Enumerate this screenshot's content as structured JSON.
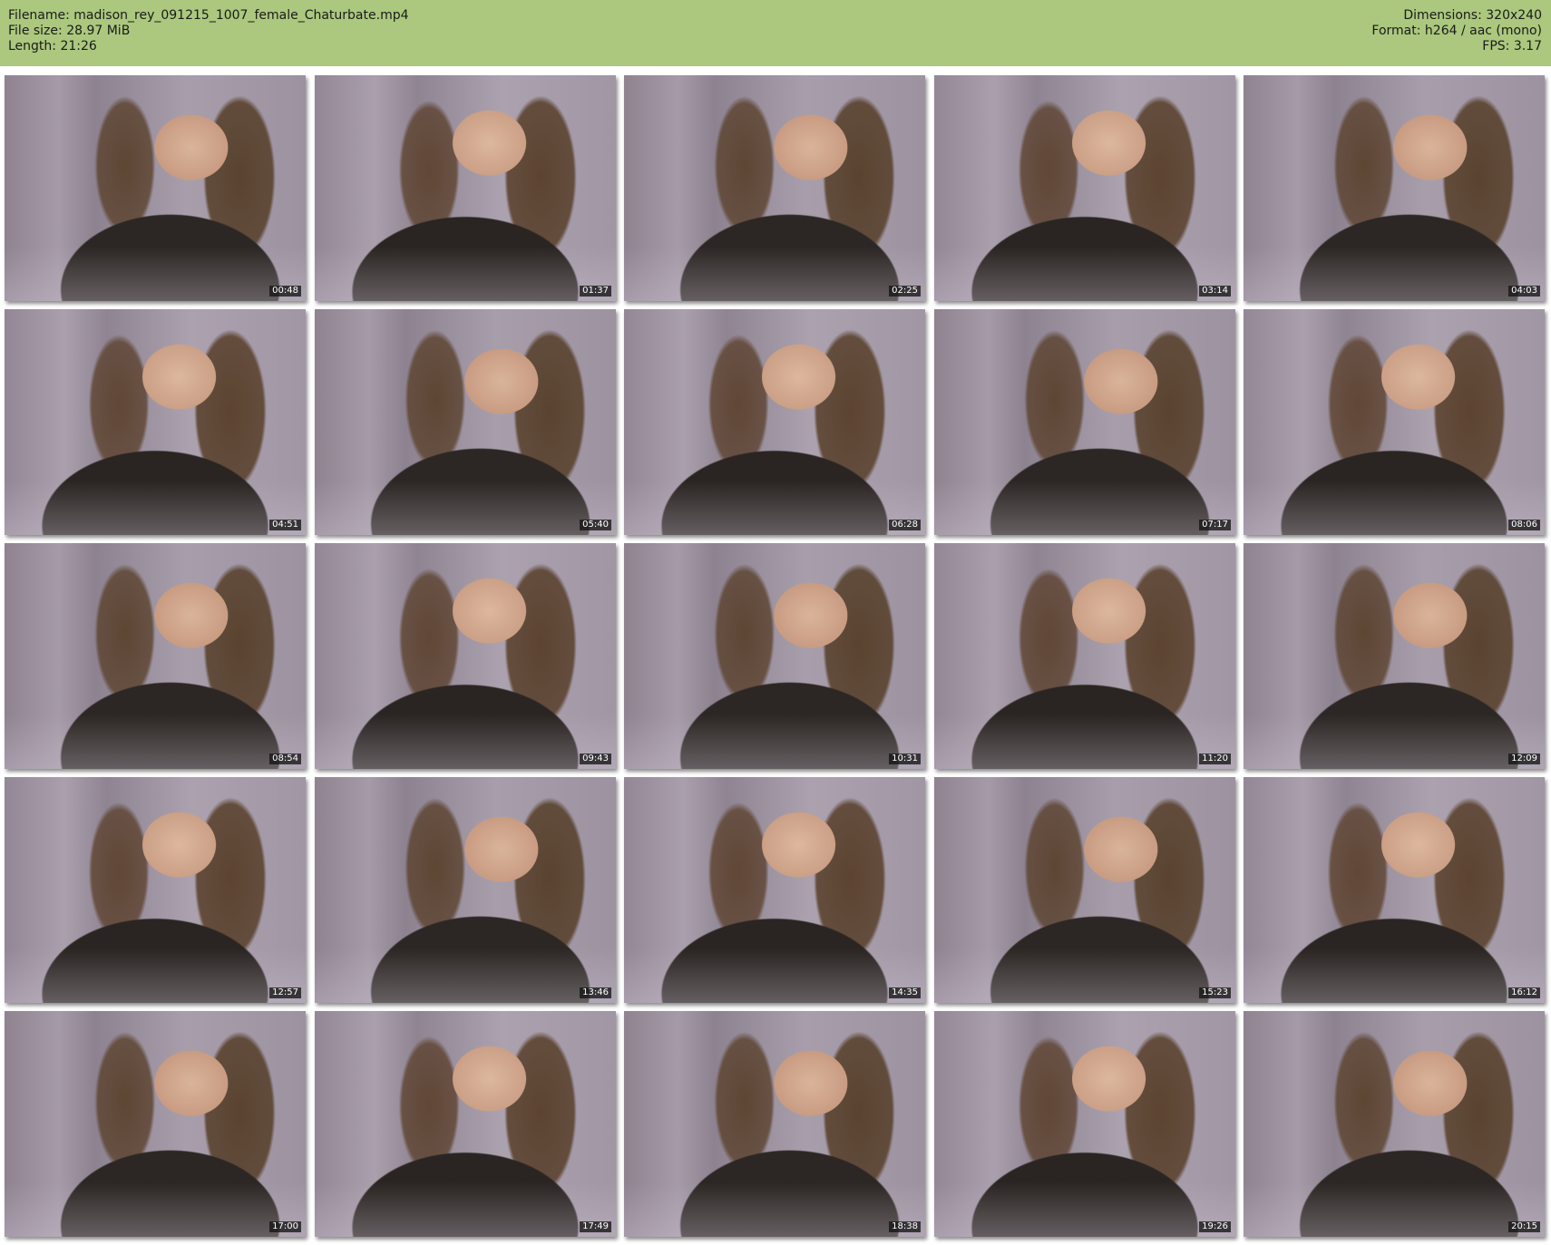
{
  "header": {
    "filename": "Filename: madison_rey_091215_1007_female_Chaturbate.mp4",
    "file_size": "File size: 28.97 MiB",
    "length": "Length: 21:26",
    "dimensions": "Dimensions: 320x240",
    "format": "Format: h264 / aac (mono)",
    "fps": "FPS: 3.17"
  },
  "colors": {
    "header_background": "#abc87e",
    "page_background": "#ffffff",
    "timestamp_background": "#141414"
  },
  "thumbnails": [
    {
      "timestamp": "00:48"
    },
    {
      "timestamp": "01:37"
    },
    {
      "timestamp": "02:25"
    },
    {
      "timestamp": "03:14"
    },
    {
      "timestamp": "04:03"
    },
    {
      "timestamp": "04:51"
    },
    {
      "timestamp": "05:40"
    },
    {
      "timestamp": "06:28"
    },
    {
      "timestamp": "07:17"
    },
    {
      "timestamp": "08:06"
    },
    {
      "timestamp": "08:54"
    },
    {
      "timestamp": "09:43"
    },
    {
      "timestamp": "10:31"
    },
    {
      "timestamp": "11:20"
    },
    {
      "timestamp": "12:09"
    },
    {
      "timestamp": "12:57"
    },
    {
      "timestamp": "13:46"
    },
    {
      "timestamp": "14:35"
    },
    {
      "timestamp": "15:23"
    },
    {
      "timestamp": "16:12"
    },
    {
      "timestamp": "17:00"
    },
    {
      "timestamp": "17:49"
    },
    {
      "timestamp": "18:38"
    },
    {
      "timestamp": "19:26"
    },
    {
      "timestamp": "20:15"
    }
  ]
}
